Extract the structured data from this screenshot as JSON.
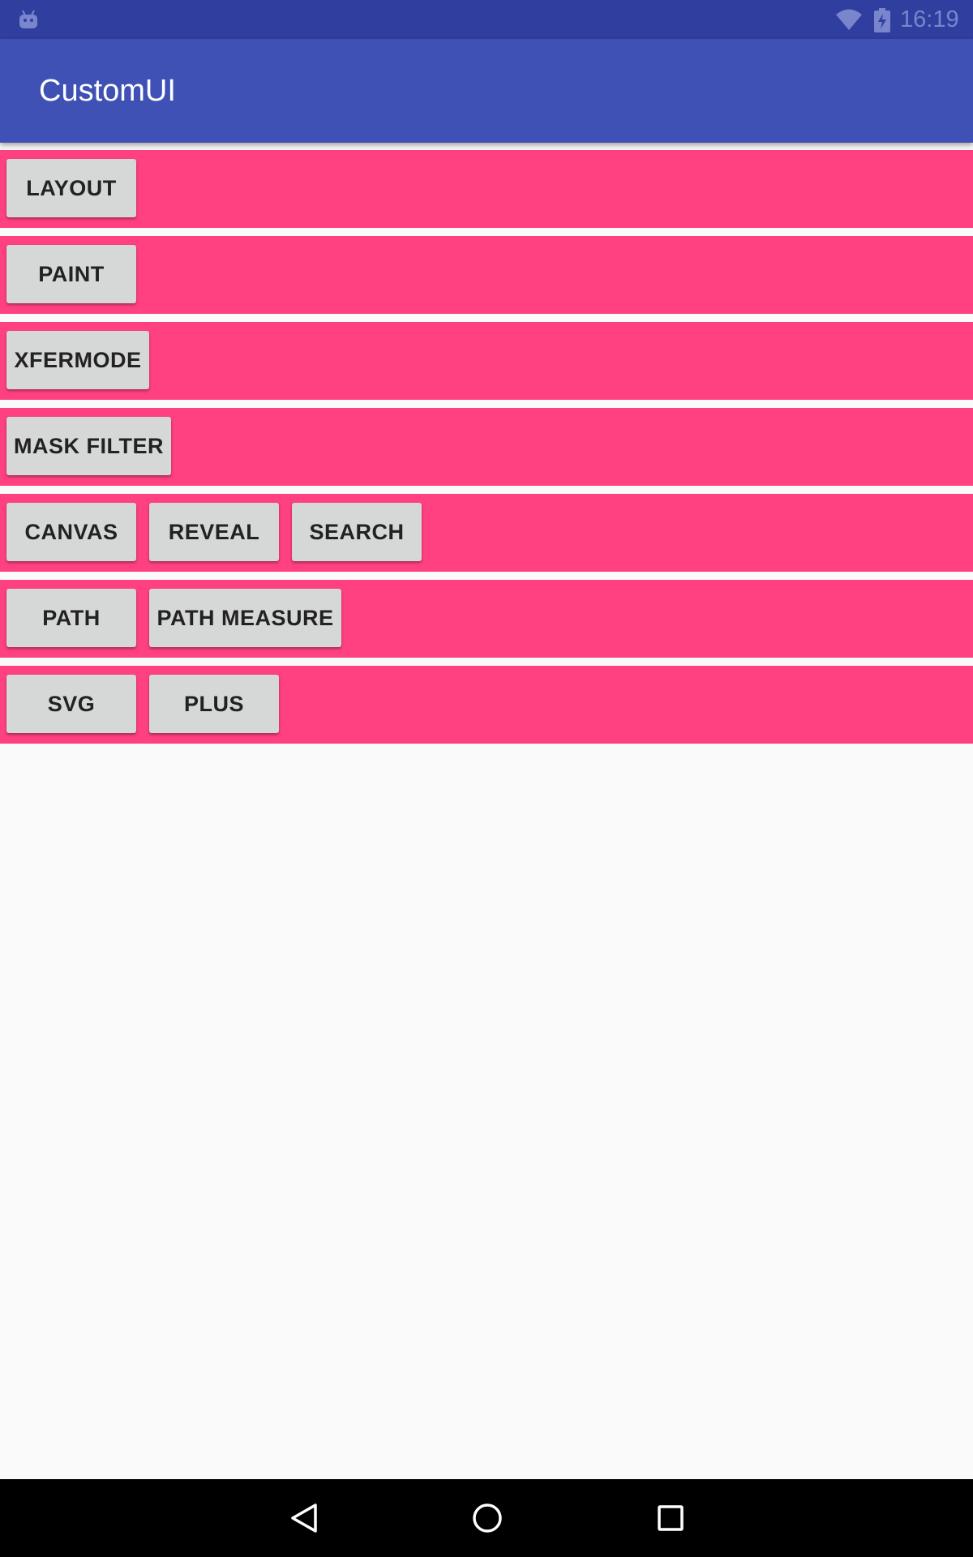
{
  "status_bar": {
    "time": "16:19",
    "icons": [
      "android-icon",
      "wifi-icon",
      "battery-charging-icon"
    ]
  },
  "app_bar": {
    "title": "CustomUI"
  },
  "rows": [
    [
      "LAYOUT"
    ],
    [
      "PAINT"
    ],
    [
      "XFERMODE"
    ],
    [
      "MASK FILTER"
    ],
    [
      "CANVAS",
      "REVEAL",
      "SEARCH"
    ],
    [
      "PATH",
      "PATH MEASURE"
    ],
    [
      "SVG",
      "PLUS"
    ]
  ],
  "nav_bar": {
    "icons": [
      "back-icon",
      "home-icon",
      "recents-icon"
    ]
  },
  "colors": {
    "status_bar": "#303f9f",
    "app_bar": "#3f51b5",
    "row_background": "#ff4081",
    "button": "#d6d7d7",
    "page_background": "#fafafa"
  }
}
